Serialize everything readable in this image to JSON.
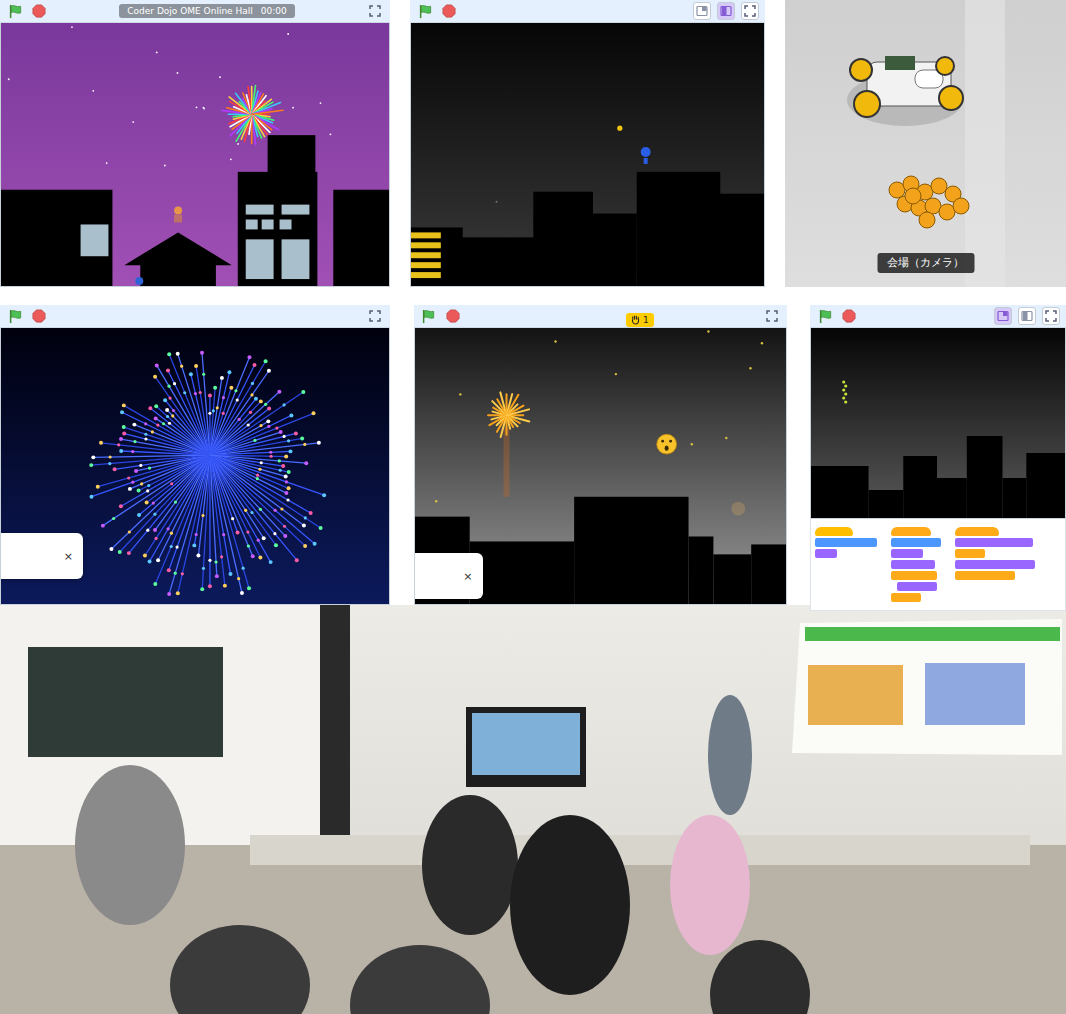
{
  "top_row": [
    {
      "kind": "stage",
      "scene": "city-purple",
      "title": "Coder Dojo OME Online Hall",
      "time": "00:00",
      "view_modes": []
    },
    {
      "kind": "stage",
      "scene": "city-dark",
      "view_modes": [
        {
          "selected": false
        },
        {
          "selected": true
        }
      ]
    },
    {
      "kind": "camera",
      "caption": "会場（カメラ）"
    }
  ],
  "middle_row": [
    {
      "kind": "stage",
      "scene": "burst-blue",
      "view_modes": [],
      "popup_close": "×"
    },
    {
      "kind": "stage",
      "scene": "burst-orange",
      "view_modes": [],
      "popup_close": "×",
      "badge": "1"
    },
    {
      "kind": "stage",
      "scene": "city-code",
      "view_modes": [
        {
          "selected": true
        },
        {
          "selected": false
        }
      ]
    }
  ],
  "bottom_photo": {
    "kind": "photo"
  }
}
